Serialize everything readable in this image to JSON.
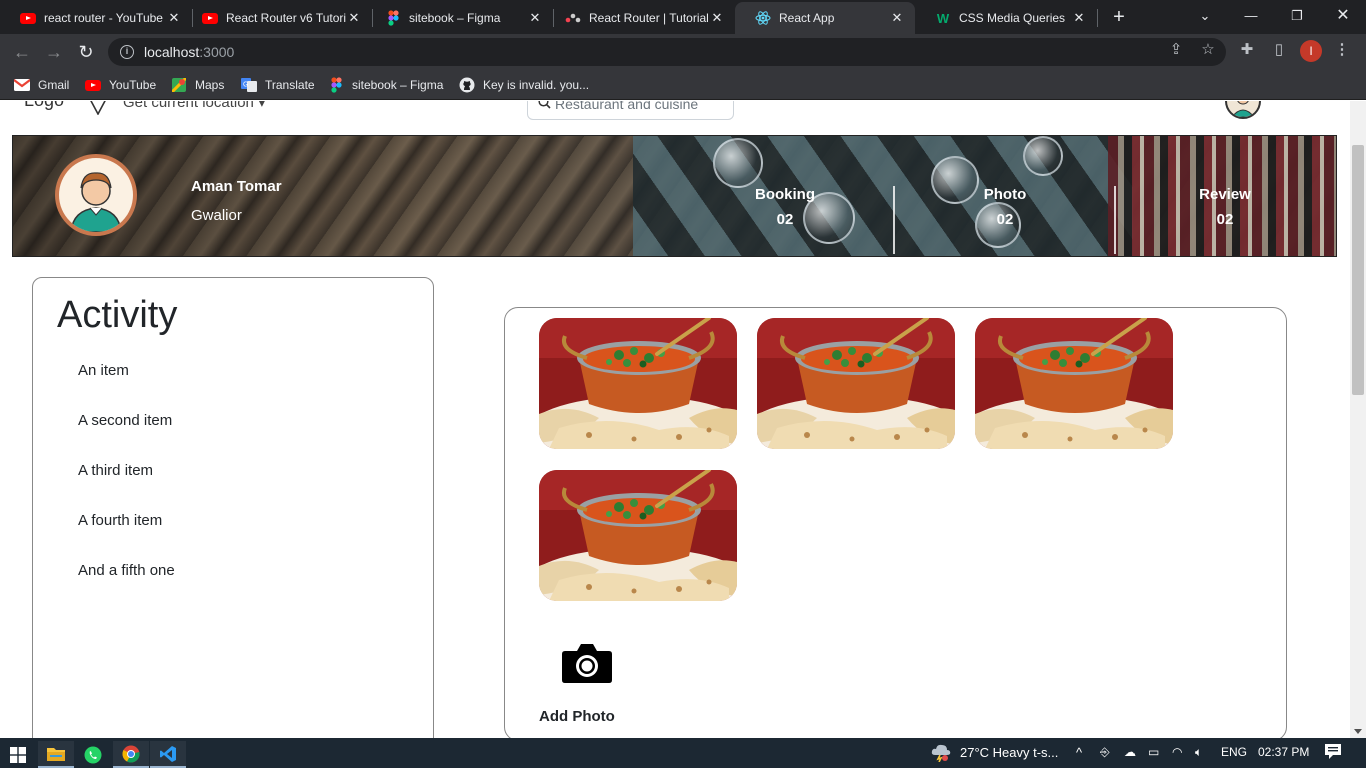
{
  "browser": {
    "tabs": [
      {
        "title": "react router - YouTube",
        "icon": "youtube-icon"
      },
      {
        "title": "React Router v6 Tutorial",
        "icon": "youtube-icon"
      },
      {
        "title": "sitebook – Figma",
        "icon": "figma-icon"
      },
      {
        "title": "React Router | Tutorial",
        "icon": "react-router-icon"
      },
      {
        "title": "React App",
        "icon": "react-icon",
        "active": true
      },
      {
        "title": "CSS Media Queries",
        "icon": "w3schools-icon"
      }
    ],
    "url_host": "localhost",
    "url_port": ":3000",
    "bookmarks": [
      {
        "label": "Gmail",
        "icon": "gmail-icon"
      },
      {
        "label": "YouTube",
        "icon": "youtube-icon"
      },
      {
        "label": "Maps",
        "icon": "maps-icon"
      },
      {
        "label": "Translate",
        "icon": "translate-icon"
      },
      {
        "label": "sitebook – Figma",
        "icon": "figma-icon"
      },
      {
        "label": "Key is invalid. you...",
        "icon": "github-icon"
      }
    ],
    "profile_initial": "I"
  },
  "page": {
    "navbar": {
      "logo": "Logo",
      "location": "Get current location",
      "search_placeholder": "Restaurant and cuisine"
    },
    "profile": {
      "name": "Aman Tomar",
      "city": "Gwalior",
      "stats": [
        {
          "label": "Booking",
          "value": "02"
        },
        {
          "label": "Photo",
          "value": "02"
        },
        {
          "label": "Review",
          "value": "02"
        }
      ]
    },
    "activity": {
      "title": "Activity",
      "items": [
        "An item",
        "A second item",
        "A third item",
        "A fourth item",
        "And a fifth one"
      ]
    },
    "gallery": {
      "photo_count": 4,
      "add_photo_label": "Add Photo"
    }
  },
  "taskbar": {
    "weather": "27°C  Heavy t-s...",
    "language": "ENG",
    "time": "02:37 PM"
  },
  "colors": {
    "chrome_dark": "#202124",
    "chrome_toolbar": "#35363a",
    "taskbar": "#1c2833",
    "text": "#212529"
  }
}
